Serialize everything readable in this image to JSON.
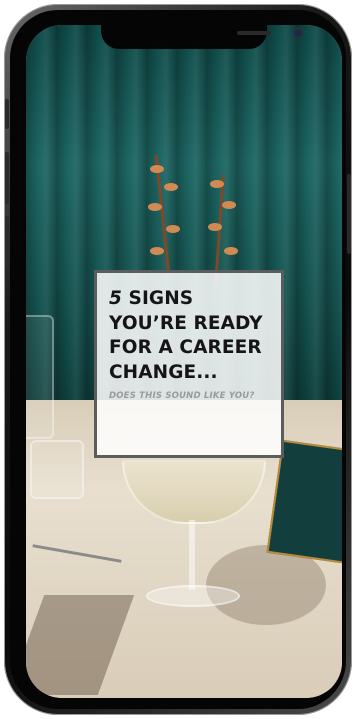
{
  "post": {
    "headline_number": "5",
    "headline_rest": " SIGNS YOU’RE READY FOR A CAREER CHANGE...",
    "subline": "DOES THIS SOUND LIKE YOU?"
  },
  "colors": {
    "curtain": "#15524f",
    "table": "#e0d6c3",
    "card_bg": "#ffffff",
    "card_border": "#5c5c5c",
    "headline": "#151515",
    "subline": "#9a9a9a"
  }
}
